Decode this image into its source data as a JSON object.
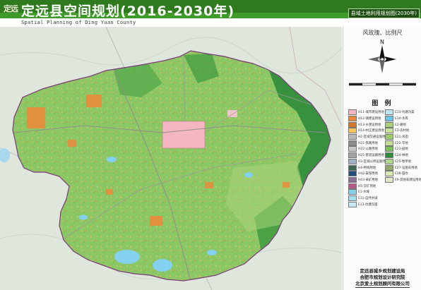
{
  "header": {
    "logo_text": "定远",
    "title": "定远县空间规划(2016-2030年)",
    "subtitle": "Spatial Planning of Ding Yuan County",
    "map_type_label": "县域土地利用规划图(2030年)"
  },
  "panel": {
    "compass_label": "风玫瑰、比例尺",
    "compass_north": "N",
    "legend_title": "图 例",
    "legend_left": [
      {
        "label": "H11-城市建设用地",
        "color": "#f4b6c2"
      },
      {
        "label": "H12-镇建设用地",
        "color": "#e9893b"
      },
      {
        "label": "H13-乡建设用地",
        "color": "#d4752a"
      },
      {
        "label": "H14-村庄建设用地",
        "color": "#f6c75a"
      },
      {
        "label": "H2-区域交通设施用地",
        "color": "#b8b8b8"
      },
      {
        "label": "H21-铁路用地",
        "color": "#8d8d8d"
      },
      {
        "label": "H22-公路用地",
        "color": "#c7c7c7"
      },
      {
        "label": "H25-管道运输用地",
        "color": "#a5a5a5"
      },
      {
        "label": "H3-区域公用设施用地",
        "color": "#9fb0c7"
      },
      {
        "label": "H4-特殊用地",
        "color": "#3c6b51"
      },
      {
        "label": "H42-安保用地",
        "color": "#1f4f7d"
      },
      {
        "label": "H43-采矿用地",
        "color": "#8a6f96"
      },
      {
        "label": "H5-交矿用地",
        "color": "#b65a8c"
      },
      {
        "label": "E1-水域",
        "color": "#84d0ef"
      },
      {
        "label": "E11-自然水域",
        "color": "#a7def4"
      },
      {
        "label": "E13-坑塘沟渠",
        "color": "#c2ebf6"
      }
    ],
    "legend_right": [
      {
        "label": "E13-坑塘沟渠",
        "color": "#bfe7f2"
      },
      {
        "label": "E14-水库",
        "color": "#6fc3e6"
      },
      {
        "label": "E2-耕地",
        "color": "#a9d27a"
      },
      {
        "label": "E3-农村地",
        "color": "#c6e29b"
      },
      {
        "label": "E21-水田",
        "color": "#9bcc6b"
      },
      {
        "label": "E22-旱地",
        "color": "#c2de93"
      },
      {
        "label": "E23-园地",
        "color": "#7fbf5b"
      },
      {
        "label": "E24-林地",
        "color": "#2f8b3a"
      },
      {
        "label": "E25-牧草地",
        "color": "#b5d88f"
      },
      {
        "label": "E27-设施农用地",
        "color": "#8fa86b"
      },
      {
        "label": "E28-田坎",
        "color": "#d8e8b6"
      },
      {
        "label": "E9-其他非建设用地",
        "color": "#e3e3c6"
      }
    ],
    "credits": [
      "定远县城乡规划建设局",
      "合肥市规划设计研究院",
      "北京爱土规划顾问有限公司"
    ]
  },
  "colors": {
    "header_green": "#2f7a1f",
    "base_green": "#8cc765",
    "forest_green": "#2f8b3a",
    "water_blue": "#84d0ef",
    "urban_pink": "#f4b6c2",
    "town_orange": "#e9893b"
  }
}
